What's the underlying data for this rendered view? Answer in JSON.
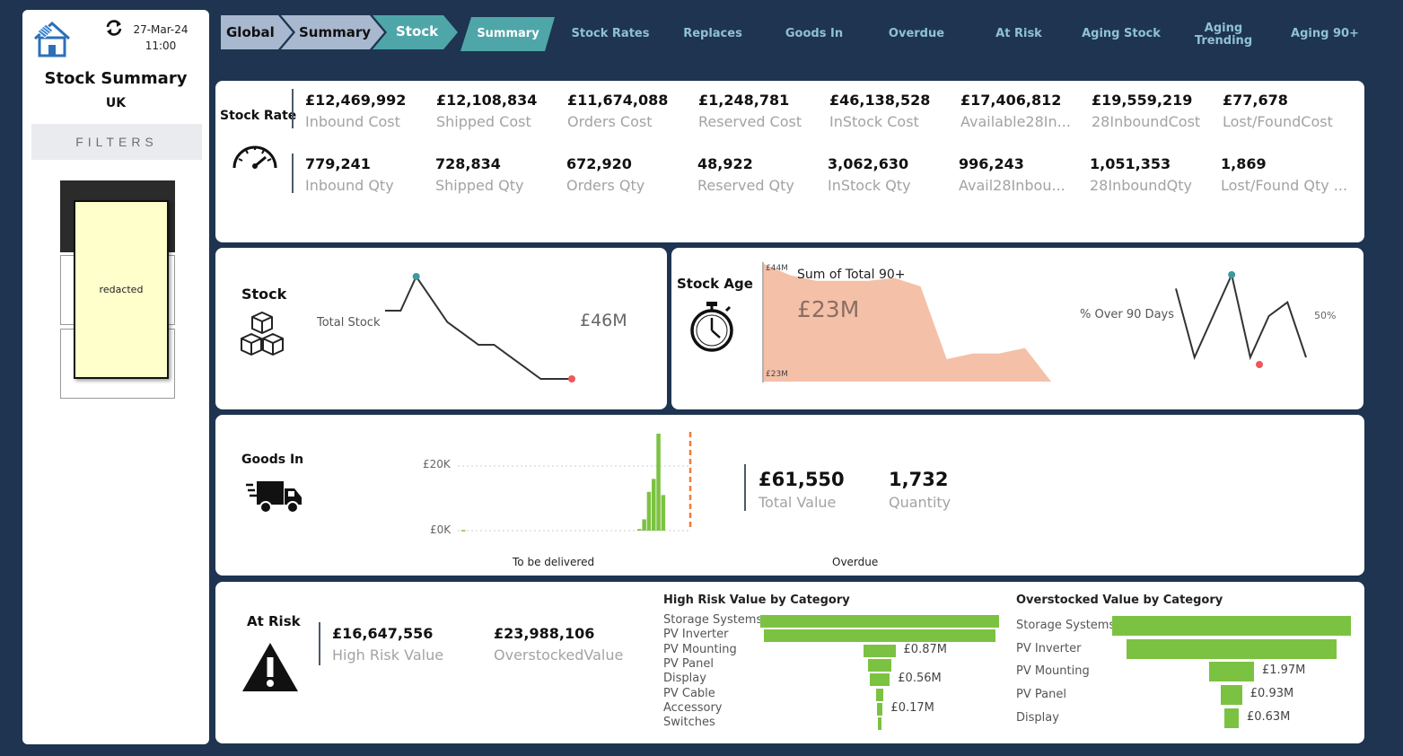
{
  "sidebar": {
    "date": "27-Mar-24",
    "time": "11:00",
    "title": "Stock Summary",
    "region": "UK",
    "filters_label": "FILTERS",
    "redacted_label": "redacted"
  },
  "breadcrumb": [
    "Global",
    "Summary",
    "Stock"
  ],
  "tabs": [
    "Summary",
    "Stock Rates",
    "Replaces",
    "Goods In",
    "Overdue",
    "At Risk",
    "Aging Stock",
    "Aging Trending",
    "Aging 90+"
  ],
  "active_tab": "Summary",
  "stock_rate": {
    "title": "Stock Rate",
    "cost_row": [
      {
        "value": "£12,469,992",
        "label": "Inbound Cost"
      },
      {
        "value": "£12,108,834",
        "label": "Shipped Cost"
      },
      {
        "value": "£11,674,088",
        "label": "Orders Cost"
      },
      {
        "value": "£1,248,781",
        "label": "Reserved Cost"
      },
      {
        "value": "£46,138,528",
        "label": "InStock Cost"
      },
      {
        "value": "£17,406,812",
        "label": "Available28In..."
      },
      {
        "value": "£19,559,219",
        "label": "28InboundCost"
      },
      {
        "value": "£77,678",
        "label": "Lost/FoundCost"
      }
    ],
    "qty_row": [
      {
        "value": "779,241",
        "label": "Inbound Qty"
      },
      {
        "value": "728,834",
        "label": "Shipped Qty"
      },
      {
        "value": "672,920",
        "label": "Orders Qty"
      },
      {
        "value": "48,922",
        "label": "Reserved Qty"
      },
      {
        "value": "3,062,630",
        "label": "InStock Qty"
      },
      {
        "value": "996,243",
        "label": "Avail28Inbou..."
      },
      {
        "value": "1,051,353",
        "label": "28InboundQty"
      },
      {
        "value": "1,869",
        "label": "Lost/Found Qty ..."
      }
    ]
  },
  "stock": {
    "title": "Stock",
    "metric_label": "Total Stock",
    "value": "£46M"
  },
  "stock_age": {
    "title": "Stock Age",
    "area_title": "Sum of Total 90+",
    "area_value": "£23M",
    "axis_top": "£44M",
    "axis_bottom": "£23M",
    "pct_label": "% Over 90 Days",
    "pct_value": "50%"
  },
  "goods_in": {
    "title": "Goods In",
    "tick_top": "£20K",
    "tick_bottom": "£0K",
    "x_label_left": "To be delivered",
    "x_label_right": "Overdue",
    "total_value": "£61,550",
    "total_value_label": "Total Value",
    "quantity": "1,732",
    "quantity_label": "Quantity"
  },
  "at_risk": {
    "title": "At Risk",
    "high_risk_value": "£16,647,556",
    "high_risk_label": "High Risk Value",
    "overstocked_value": "£23,988,106",
    "overstocked_label": "OverstockedValue"
  },
  "chart_data": [
    {
      "type": "line",
      "title": "",
      "series": [
        {
          "values": [
            44,
            44,
            45.5,
            44.5,
            43.5,
            43,
            42.5,
            42.5,
            42,
            41.5,
            41,
            41,
            41
          ]
        }
      ]
    },
    {
      "type": "area",
      "title": "Sum of Total 90+",
      "ylim": [
        23,
        44
      ],
      "series": [
        {
          "values": [
            44,
            42,
            41,
            41,
            41,
            41.5,
            40,
            27,
            28,
            28,
            29,
            23
          ]
        }
      ]
    },
    {
      "type": "line",
      "title": "% Over 90 Days",
      "series": [
        {
          "values": [
            50,
            25,
            40,
            55,
            25,
            40,
            45,
            25
          ]
        }
      ]
    },
    {
      "type": "bar",
      "title": "",
      "ylabel": "",
      "ylim": [
        0,
        30000
      ],
      "values": [
        200,
        0,
        0,
        0,
        0,
        0,
        0,
        0,
        0,
        0,
        0,
        0,
        0,
        0,
        0,
        0,
        0,
        0,
        0,
        0,
        0,
        0,
        0,
        0,
        0,
        0,
        0,
        0,
        0,
        0,
        0,
        0,
        0,
        0,
        0,
        0,
        0,
        500,
        3500,
        12000,
        16000,
        30000,
        11000
      ]
    },
    {
      "type": "bar",
      "title": "High Risk Value by Category",
      "categories": [
        "Storage Systems",
        "PV Inverter",
        "PV Mounting",
        "PV Panel",
        "Display",
        "PV Cable",
        "Accessory",
        "Switches"
      ],
      "values": [
        6.6,
        6.4,
        0.87,
        0.65,
        0.56,
        0.2,
        0.17,
        0.1
      ],
      "labels": [
        "",
        "",
        "£0.87M",
        "",
        "£0.56M",
        "",
        "£0.17M",
        ""
      ]
    },
    {
      "type": "bar",
      "title": "Overstocked Value by Category",
      "categories": [
        "Storage Systems",
        "PV Inverter",
        "PV Mounting",
        "PV Panel",
        "Display"
      ],
      "values": [
        10.5,
        9.2,
        1.97,
        0.93,
        0.63
      ],
      "labels": [
        "",
        "",
        "£1.97M",
        "£0.93M",
        "£0.63M"
      ]
    }
  ]
}
